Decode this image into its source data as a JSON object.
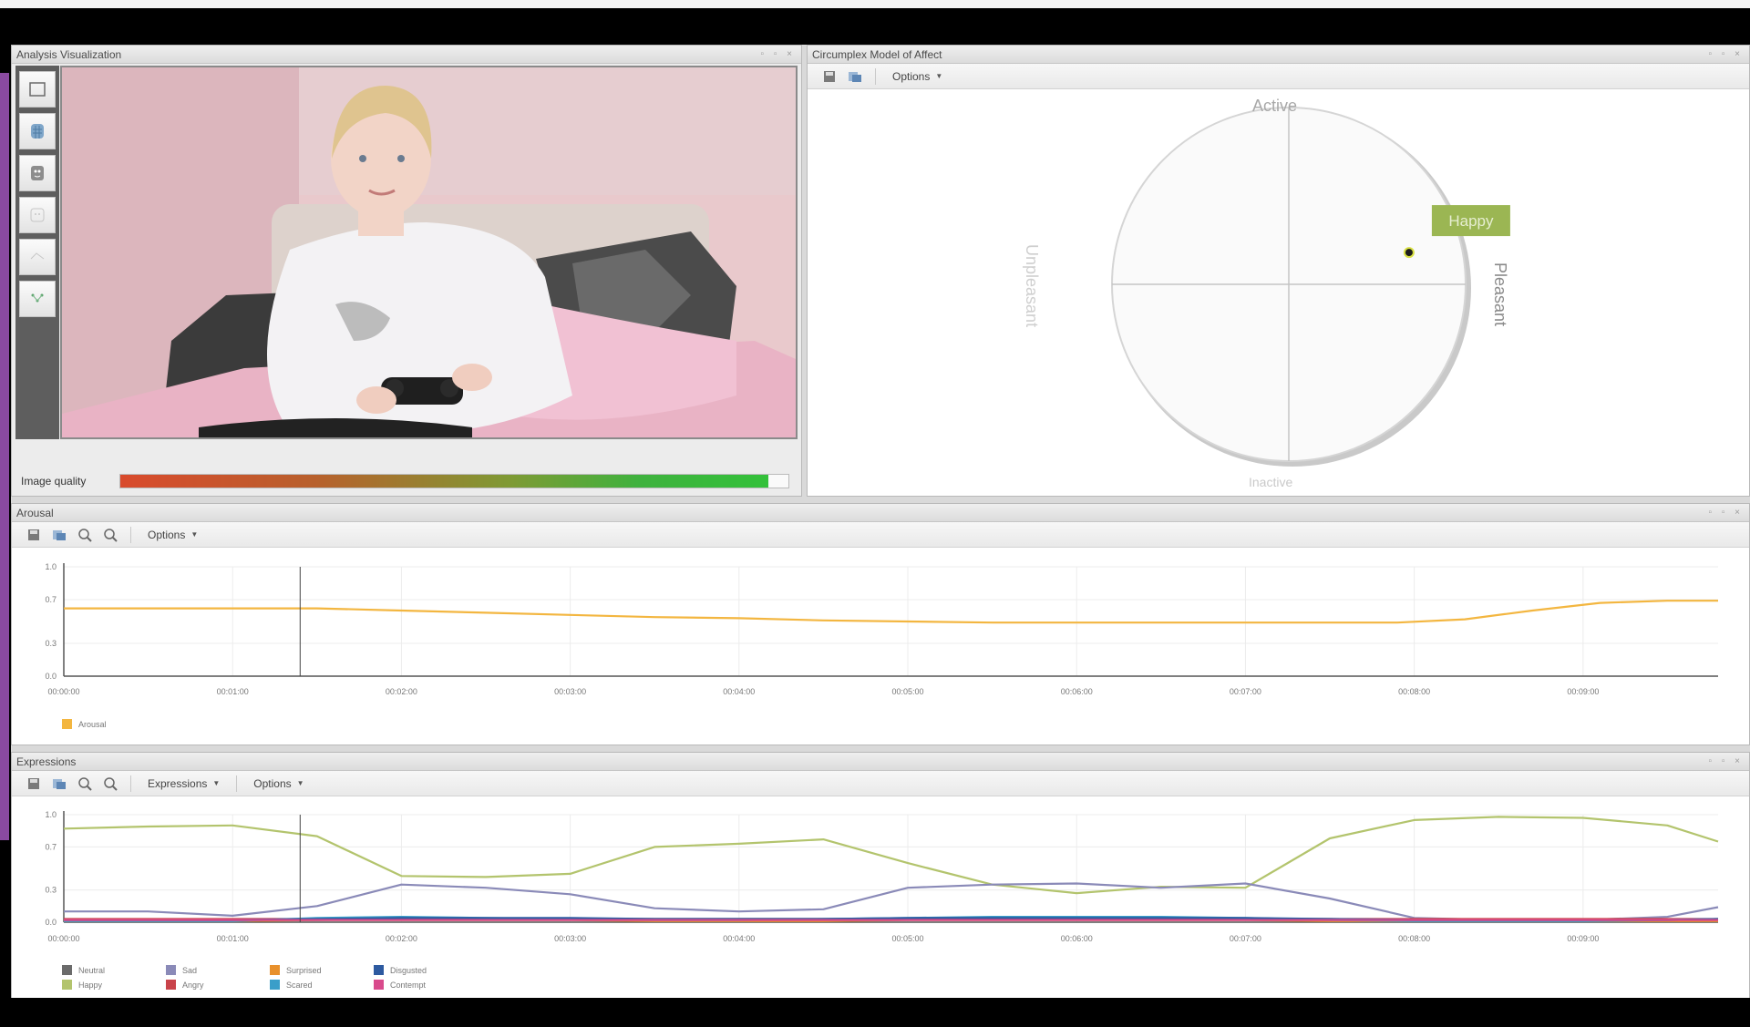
{
  "analysis": {
    "title": "Analysis Visualization",
    "quality_label": "Image quality",
    "quality_level": 0.97
  },
  "circumplex": {
    "title": "Circumplex Model of Affect",
    "options_label": "Options",
    "top_label": "Active",
    "bottom_label": "Inactive",
    "left_label": "Unpleasant",
    "right_label": "Pleasant",
    "state_label": "Happy",
    "state_valence": 0.68,
    "state_arousal": 0.18
  },
  "arousal": {
    "title": "Arousal",
    "options_label": "Options"
  },
  "expressions": {
    "title": "Expressions",
    "expressions_label": "Expressions",
    "options_label": "Options"
  },
  "chart_data": [
    {
      "type": "line",
      "title": "Arousal",
      "ylim": [
        0,
        1
      ],
      "yticks": [
        "0.0",
        "0.3",
        "0.7",
        "1.0"
      ],
      "xticks": [
        "00:00:00",
        "00:01:00",
        "00:02:00",
        "00:03:00",
        "00:04:00",
        "00:05:00",
        "00:06:00",
        "00:07:00",
        "00:08:00",
        "00:09:00"
      ],
      "x_minutes": [
        0,
        0.5,
        1,
        1.5,
        2,
        2.5,
        3,
        3.5,
        4,
        4.5,
        5,
        5.5,
        6,
        6.5,
        7,
        7.5,
        7.9,
        8.3,
        8.7,
        9.1,
        9.5,
        9.8
      ],
      "series": [
        {
          "name": "Arousal",
          "color": "#f3b640",
          "values": [
            0.62,
            0.62,
            0.62,
            0.62,
            0.6,
            0.58,
            0.56,
            0.54,
            0.53,
            0.51,
            0.5,
            0.49,
            0.49,
            0.49,
            0.49,
            0.49,
            0.49,
            0.52,
            0.6,
            0.67,
            0.69,
            0.69
          ]
        }
      ],
      "grid": true,
      "legend": "bottom-left",
      "cursor_minute": 1.4
    },
    {
      "type": "line",
      "title": "Expressions",
      "ylim": [
        0,
        1
      ],
      "yticks": [
        "0.0",
        "0.3",
        "0.7",
        "1.0"
      ],
      "xticks": [
        "00:00:00",
        "00:01:00",
        "00:02:00",
        "00:03:00",
        "00:04:00",
        "00:05:00",
        "00:06:00",
        "00:07:00",
        "00:08:00",
        "00:09:00"
      ],
      "x_minutes": [
        0,
        0.5,
        1,
        1.5,
        2,
        2.5,
        3,
        3.5,
        4,
        4.5,
        5,
        5.5,
        6,
        6.5,
        7,
        7.5,
        8,
        8.5,
        9,
        9.5,
        9.8
      ],
      "series": [
        {
          "name": "Neutral",
          "color": "#6b6b6b",
          "values": [
            0.02,
            0.02,
            0.02,
            0.02,
            0.03,
            0.03,
            0.03,
            0.03,
            0.03,
            0.03,
            0.03,
            0.03,
            0.03,
            0.03,
            0.03,
            0.03,
            0.02,
            0.02,
            0.02,
            0.02,
            0.02
          ]
        },
        {
          "name": "Happy",
          "color": "#b3c46d",
          "values": [
            0.87,
            0.89,
            0.9,
            0.8,
            0.43,
            0.42,
            0.45,
            0.7,
            0.73,
            0.77,
            0.55,
            0.35,
            0.27,
            0.33,
            0.32,
            0.78,
            0.95,
            0.98,
            0.97,
            0.9,
            0.75
          ]
        },
        {
          "name": "Sad",
          "color": "#8a8ab8",
          "values": [
            0.1,
            0.1,
            0.06,
            0.15,
            0.35,
            0.32,
            0.26,
            0.13,
            0.1,
            0.12,
            0.32,
            0.35,
            0.36,
            0.32,
            0.36,
            0.22,
            0.04,
            0.02,
            0.02,
            0.05,
            0.14
          ]
        },
        {
          "name": "Angry",
          "color": "#c9434a",
          "values": [
            0.03,
            0.03,
            0.03,
            0.03,
            0.03,
            0.03,
            0.03,
            0.03,
            0.03,
            0.03,
            0.03,
            0.03,
            0.03,
            0.03,
            0.03,
            0.03,
            0.03,
            0.03,
            0.03,
            0.03,
            0.03
          ]
        },
        {
          "name": "Surprised",
          "color": "#e8902c",
          "values": [
            0.01,
            0.01,
            0.01,
            0.02,
            0.02,
            0.02,
            0.02,
            0.01,
            0.01,
            0.01,
            0.02,
            0.02,
            0.02,
            0.02,
            0.02,
            0.01,
            0.01,
            0.01,
            0.01,
            0.01,
            0.01
          ]
        },
        {
          "name": "Scared",
          "color": "#3a9ec9",
          "values": [
            0.01,
            0.01,
            0.01,
            0.04,
            0.05,
            0.04,
            0.03,
            0.02,
            0.02,
            0.03,
            0.04,
            0.05,
            0.05,
            0.05,
            0.04,
            0.02,
            0.01,
            0.01,
            0.01,
            0.02,
            0.03
          ]
        },
        {
          "name": "Disgusted",
          "color": "#2d5aa0",
          "values": [
            0.02,
            0.02,
            0.02,
            0.03,
            0.04,
            0.04,
            0.04,
            0.03,
            0.03,
            0.03,
            0.04,
            0.04,
            0.04,
            0.04,
            0.04,
            0.03,
            0.02,
            0.02,
            0.02,
            0.02,
            0.03
          ]
        },
        {
          "name": "Contempt",
          "color": "#d94a8c",
          "values": [
            0.02,
            0.02,
            0.02,
            0.02,
            0.02,
            0.02,
            0.02,
            0.02,
            0.02,
            0.02,
            0.02,
            0.02,
            0.02,
            0.02,
            0.02,
            0.02,
            0.02,
            0.02,
            0.02,
            0.02,
            0.02
          ]
        }
      ],
      "grid": true,
      "legend": "bottom-left",
      "cursor_minute": 1.4
    }
  ]
}
